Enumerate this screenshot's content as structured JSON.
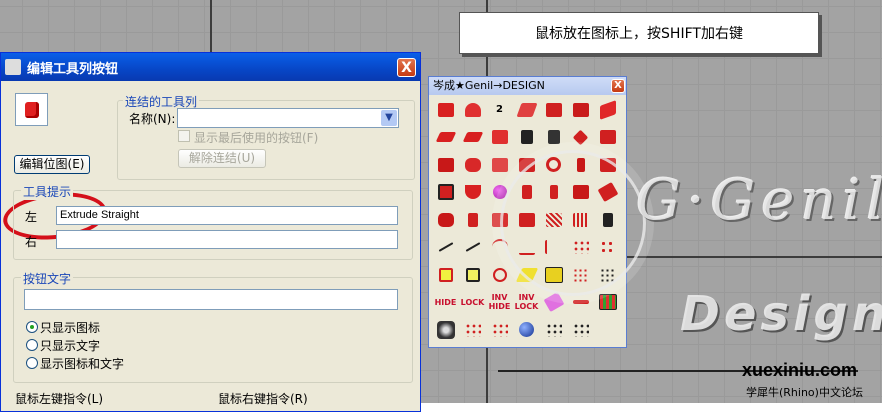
{
  "hint": {
    "text": "鼠标放在图标上，按SHIFT加右键"
  },
  "dialog": {
    "title": "编辑工具列按钮",
    "close_glyph": "X",
    "edit_bitmap_label": "编辑位图(E)",
    "linked_toolbar": {
      "group_title": "连结的工具列",
      "name_label": "名称(N):",
      "name_value": "",
      "show_last_used_label": "显示最后使用的按钮(F)",
      "unlink_label": "解除连结(U)"
    },
    "tooltip": {
      "group_title": "工具提示",
      "left_label": "左",
      "left_value": "Extrude Straight",
      "right_label": "右",
      "right_value": ""
    },
    "button_text": {
      "group_title": "按钮文字",
      "value": "",
      "options": [
        "只显示图标",
        "只显示文字",
        "显示图标和文字"
      ],
      "selected_index": 0
    },
    "left_command_label": "鼠标左键指令(L)",
    "right_command_label": "鼠标右键指令(R)"
  },
  "palette": {
    "title": "岑成★Genil→DESIGN",
    "close_glyph": "X",
    "text_icons": {
      "hide": "HIDE",
      "lock": "LOCK",
      "inv_hide": "INV HIDE",
      "inv_lock": "INV LOCK",
      "two": "2"
    }
  },
  "watermark": {
    "genil": "G·Genil",
    "design": "Design",
    "site": "xuexiniu.com",
    "site_sub": "学犀牛(Rhino)中文论坛"
  }
}
